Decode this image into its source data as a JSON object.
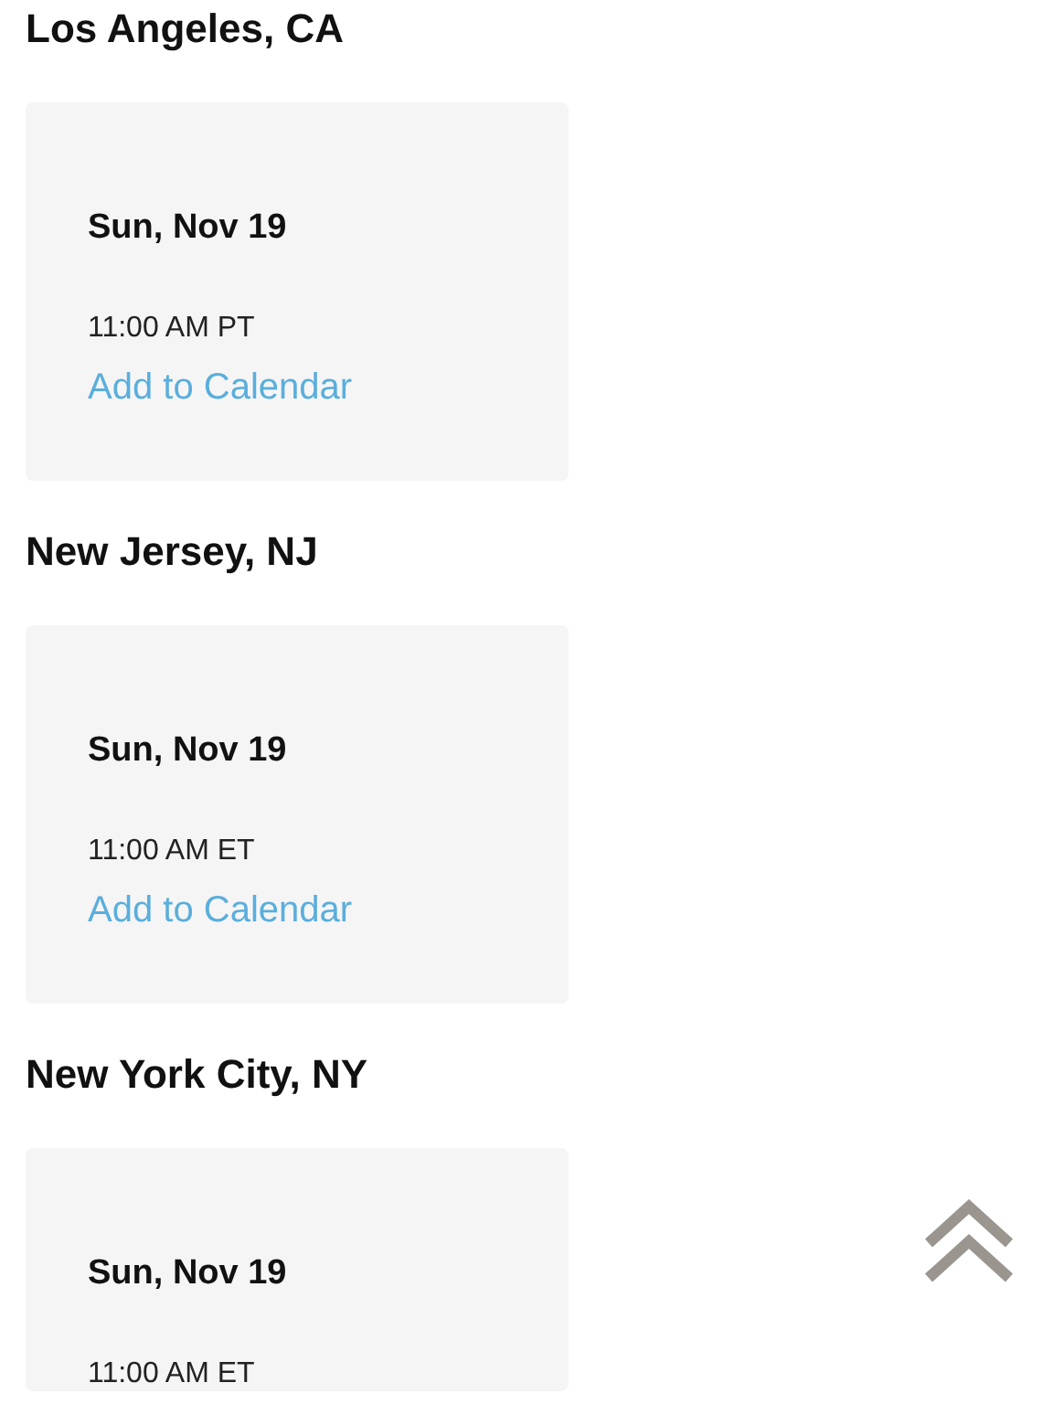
{
  "locations": [
    {
      "city": "Los Angeles, CA",
      "date": "Sun, Nov 19",
      "time": "11:00 AM PT",
      "link": "Add to Calendar"
    },
    {
      "city": "New Jersey, NJ",
      "date": "Sun, Nov 19",
      "time": "11:00 AM ET",
      "link": "Add to Calendar"
    },
    {
      "city": "New York City, NY",
      "date": "Sun, Nov 19",
      "time": "11:00 AM ET"
    }
  ]
}
